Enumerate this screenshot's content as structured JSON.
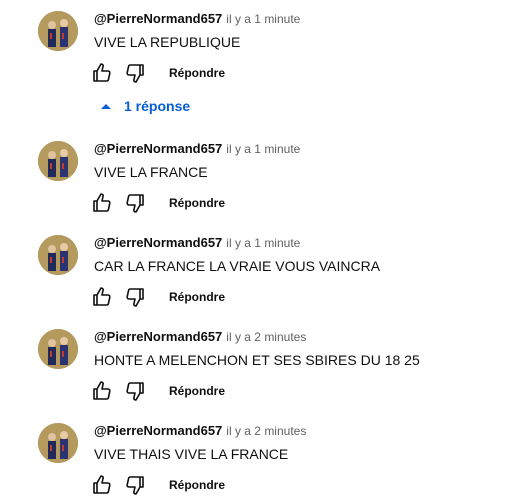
{
  "comments": [
    {
      "author": "@PierreNormand657",
      "time": "il y a 1 minute",
      "text": "VIVE LA REPUBLIQUE",
      "reply_label": "Répondre",
      "replies_label": "1 réponse"
    },
    {
      "author": "@PierreNormand657",
      "time": "il y a 1 minute",
      "text": "VIVE LA FRANCE",
      "reply_label": "Répondre"
    },
    {
      "author": "@PierreNormand657",
      "time": "il y a 1 minute",
      "text": "CAR LA FRANCE LA VRAIE VOUS VAINCRA",
      "reply_label": "Répondre"
    },
    {
      "author": "@PierreNormand657",
      "time": "il y a 2 minutes",
      "text": "HONTE A MELENCHON ET SES SBIRES DU 18 25",
      "reply_label": "Répondre"
    },
    {
      "author": "@PierreNormand657",
      "time": "il y a 2 minutes",
      "text": "VIVE THAIS VIVE LA FRANCE",
      "reply_label": "Répondre"
    }
  ],
  "icons": {
    "like": "thumb-up-icon",
    "dislike": "thumb-down-icon",
    "replies_toggle": "caret-up-icon"
  },
  "colors": {
    "link": "#065fd4",
    "text": "#0f0f0f",
    "secondary": "#606060"
  }
}
